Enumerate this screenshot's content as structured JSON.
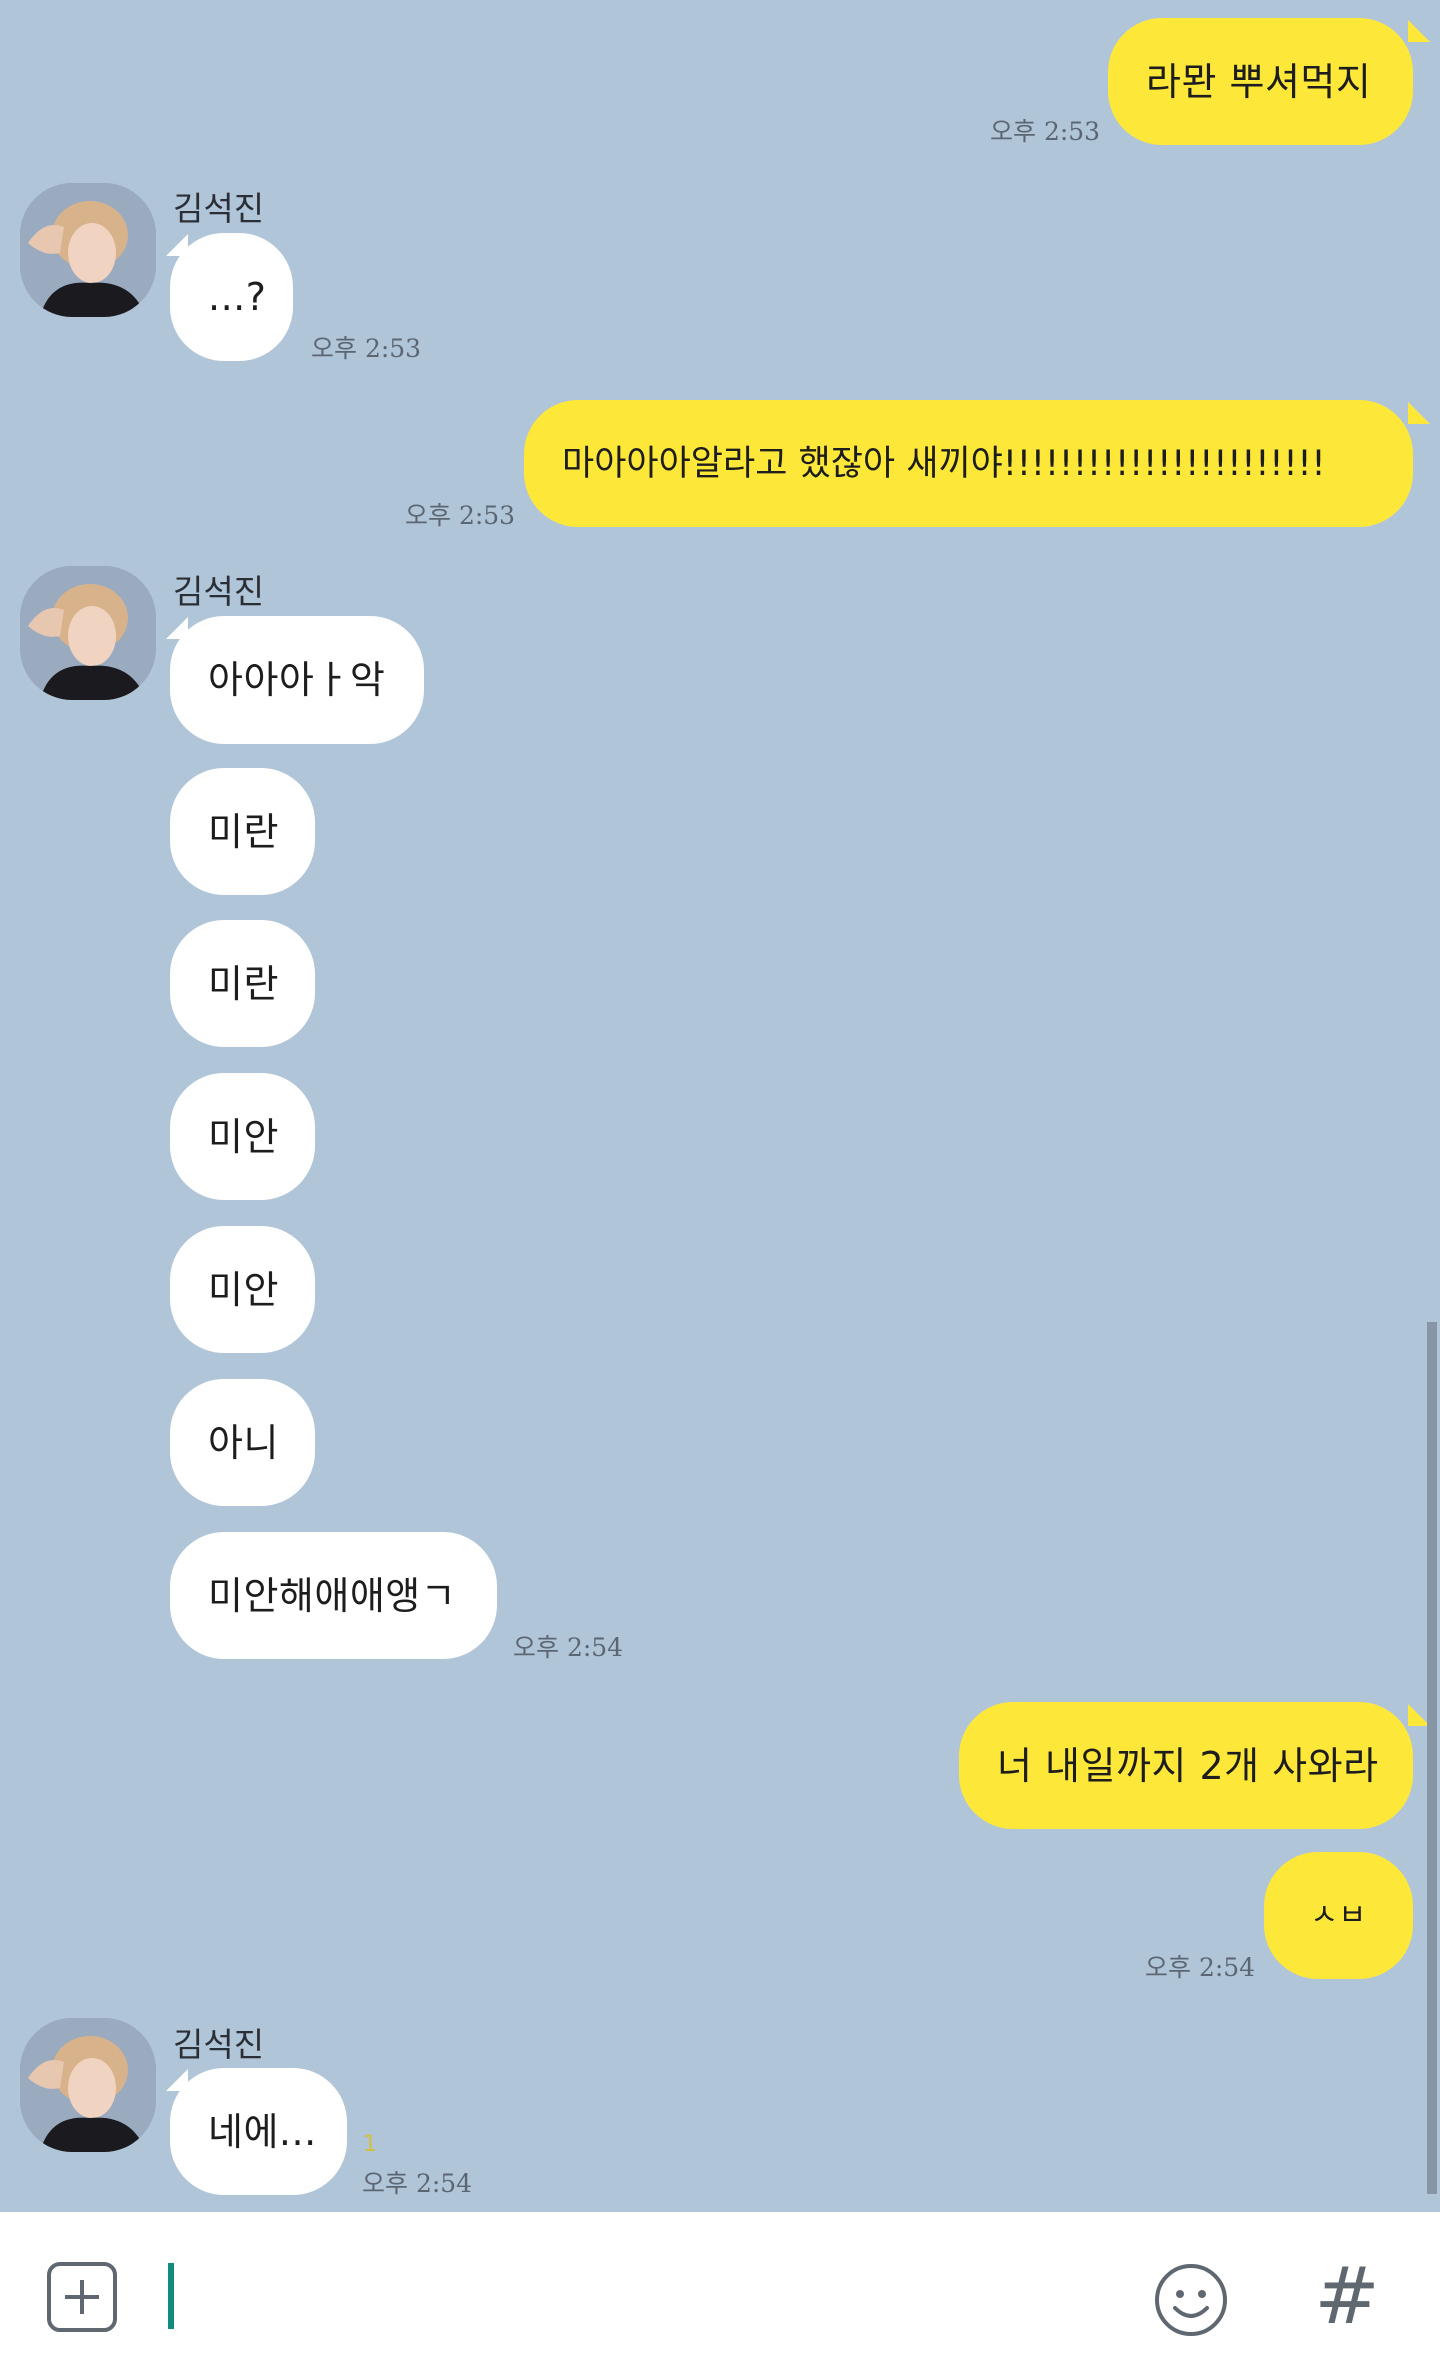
{
  "chat": {
    "contact_name": "김석진",
    "messages": [
      {
        "from": "me",
        "text": "라뫈 뿌셔먹지",
        "time": "오후 2:53"
      },
      {
        "from": "them",
        "text": "...?",
        "time": "오후 2:53"
      },
      {
        "from": "me",
        "text": "마아아아알라고 했잖아 새끼야!!!!!!!!!!!!!!!!!!!!!!!",
        "time": "오후 2:53"
      },
      {
        "from": "them",
        "text": "아아아ㅏ악"
      },
      {
        "from": "them",
        "text": "미란"
      },
      {
        "from": "them",
        "text": "미란"
      },
      {
        "from": "them",
        "text": "미안"
      },
      {
        "from": "them",
        "text": "미안"
      },
      {
        "from": "them",
        "text": "아니"
      },
      {
        "from": "them",
        "text": "미안해애애앵ㄱ",
        "time": "오후 2:54"
      },
      {
        "from": "me",
        "text": "너 내일까지 2개 사와라"
      },
      {
        "from": "me",
        "text": "ㅅㅂ",
        "time": "오후 2:54"
      },
      {
        "from": "them",
        "text": "네에...",
        "time": "오후 2:54",
        "unread": "1"
      }
    ]
  },
  "composer": {
    "input_value": "",
    "plus_icon": "plus-square-icon",
    "emoji_icon": "smiley-icon",
    "hash_icon": "hash-icon",
    "hash_label": "#"
  },
  "colors": {
    "background": "#b1c5d9",
    "my_bubble": "#fde83a",
    "their_bubble": "#ffffff",
    "caret": "#118d80"
  }
}
